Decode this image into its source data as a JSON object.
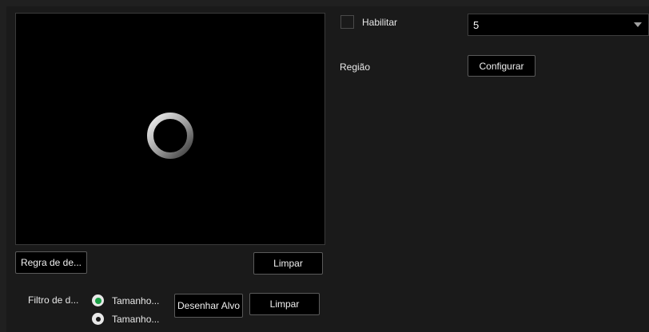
{
  "preview": {
    "loading_icon": "loading-ring-icon"
  },
  "buttons": {
    "rule_label": "Regra de de...",
    "clear_label": "Limpar",
    "draw_target_label": "Desenhar Alvo",
    "clear2_label": "Limpar",
    "configure_label": "Configurar"
  },
  "filter": {
    "label": "Filtro de d...",
    "options": [
      {
        "label": "Tamanho...",
        "selected": true
      },
      {
        "label": "Tamanho...",
        "selected": false
      }
    ]
  },
  "enable": {
    "label": "Habilitar",
    "checked": false
  },
  "select": {
    "value": "5"
  },
  "region": {
    "label": "Região"
  },
  "colors": {
    "background": "#1a1a1a",
    "accent": "#1aa046"
  }
}
